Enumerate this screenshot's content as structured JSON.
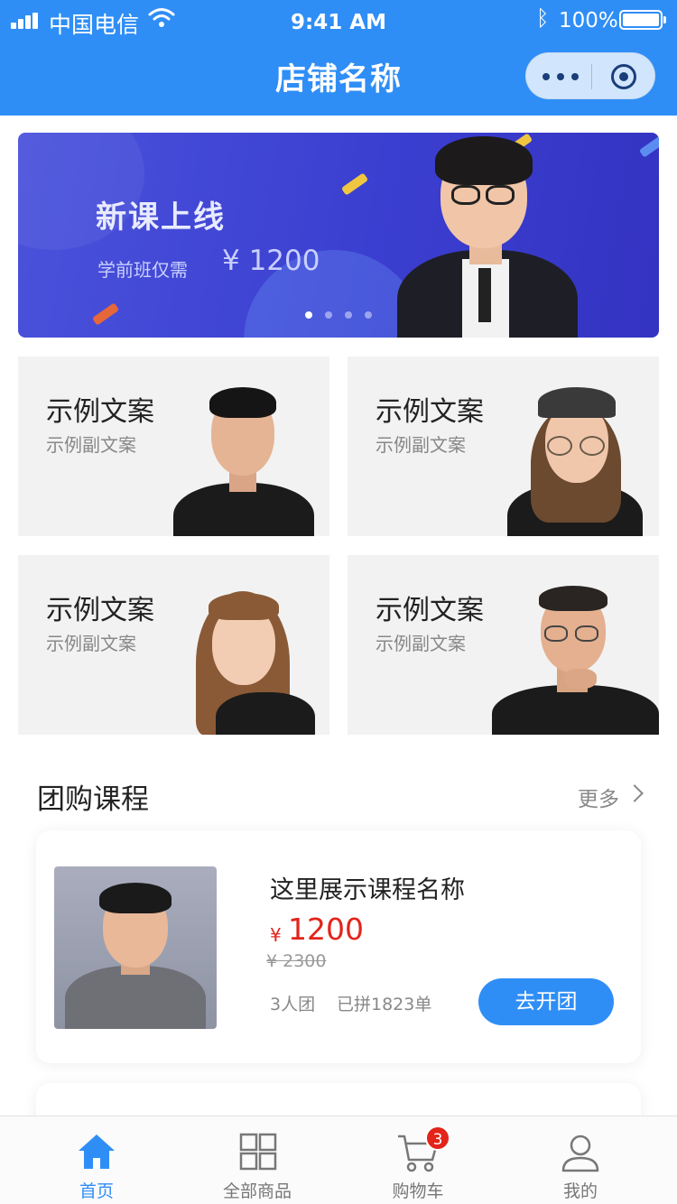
{
  "status_bar": {
    "carrier": "中国电信",
    "time": "9:41 AM",
    "battery": "100%"
  },
  "nav": {
    "title": "店铺名称",
    "more_icon": "ellipsis-icon",
    "close_icon": "target-circle-icon"
  },
  "banner": {
    "title": "新课上线",
    "subtitle": "学前班仅需",
    "price": "¥ 1200",
    "slide_count": 4,
    "active_slide": 1
  },
  "cards": [
    {
      "title": "示例文案",
      "subtitle": "示例副文案"
    },
    {
      "title": "示例文案",
      "subtitle": "示例副文案"
    },
    {
      "title": "示例文案",
      "subtitle": "示例副文案"
    },
    {
      "title": "示例文案",
      "subtitle": "示例副文案"
    }
  ],
  "group_buy": {
    "section_title": "团购课程",
    "more_label": "更多",
    "course": {
      "name": "这里展示课程名称",
      "currency": "¥",
      "price": "1200",
      "original_price": "¥ 2300",
      "group_size": "3人团",
      "joined": "已拼1823单",
      "button_label": "去开团"
    }
  },
  "tabbar": {
    "items": [
      {
        "label": "首页",
        "icon": "home-icon",
        "active": true
      },
      {
        "label": "全部商品",
        "icon": "grid-icon",
        "active": false
      },
      {
        "label": "购物车",
        "icon": "cart-icon",
        "active": false,
        "badge": "3"
      },
      {
        "label": "我的",
        "icon": "user-icon",
        "active": false
      }
    ]
  },
  "colors": {
    "primary": "#2f8ef6",
    "price_red": "#e3241b",
    "banner_bg": "#3b3fd0",
    "card_bg": "#f2f2f2"
  }
}
